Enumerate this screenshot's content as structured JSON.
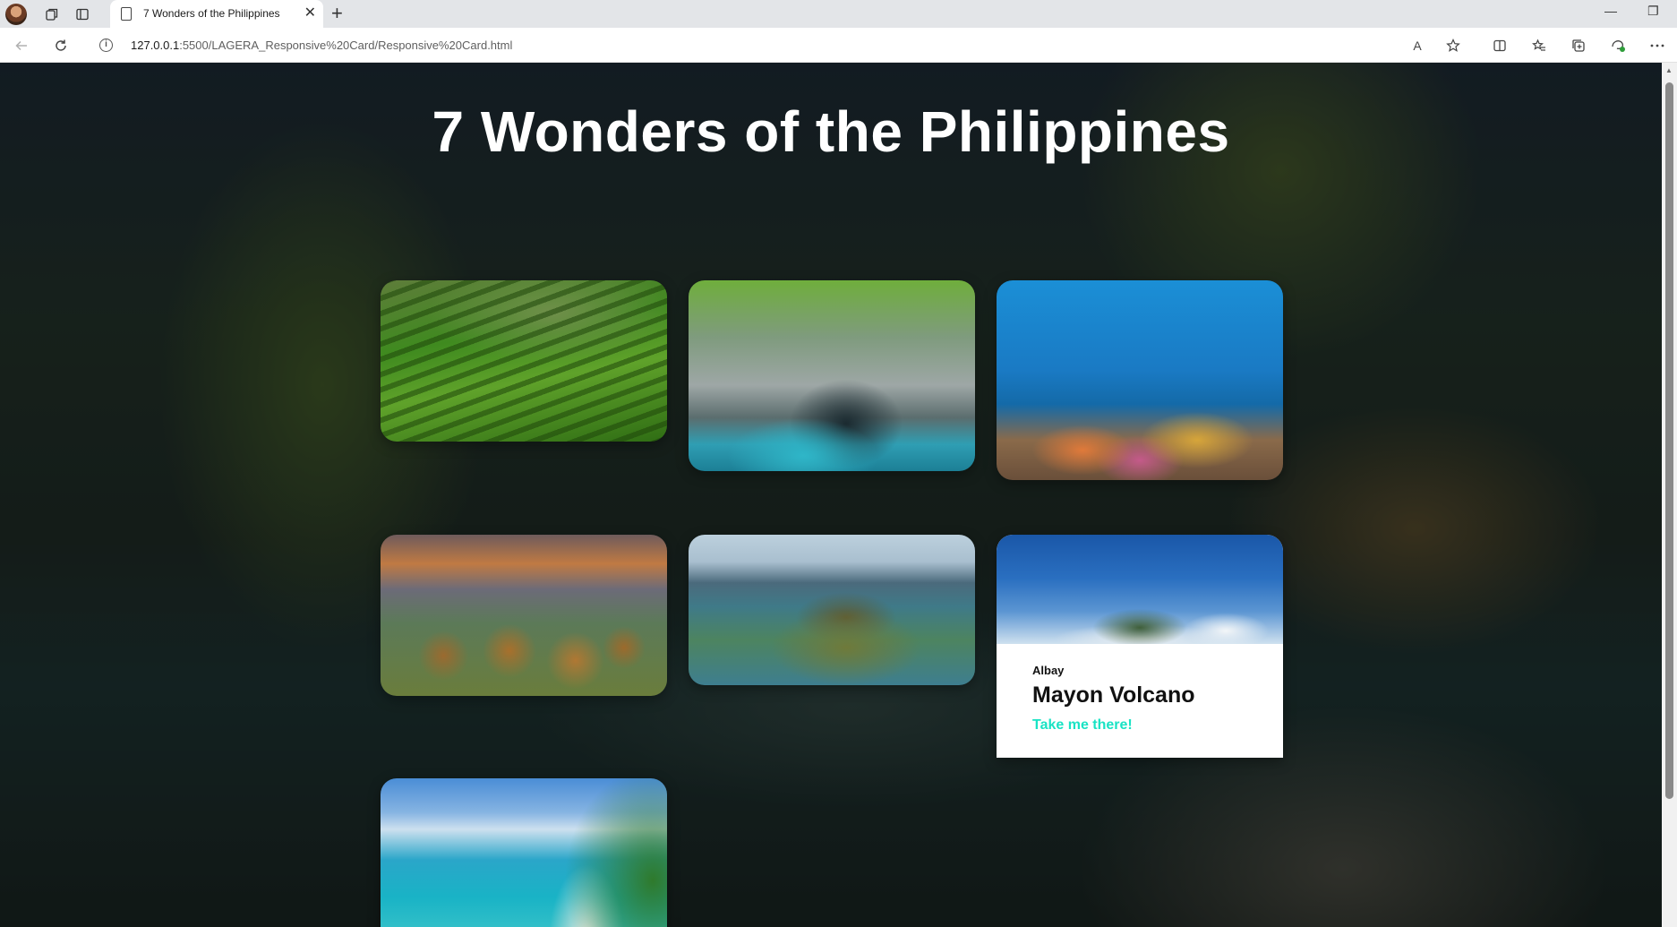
{
  "browser": {
    "tab_title": "7 Wonders of the Philippines",
    "new_tab_symbol": "+",
    "close_symbol": "✕",
    "url_host": "127.0.0.1",
    "url_path": ":5500/LAGERA_Responsive%20Card/Responsive%20Card.html",
    "read_aloud_label": "A",
    "minimize_symbol": "—",
    "maximize_symbol": "❐"
  },
  "page": {
    "title": "7 Wonders of the Philippines"
  },
  "cards": [
    {
      "image": "Banaue Rice Terraces"
    },
    {
      "image": "Underground River"
    },
    {
      "image": "Coral Reef"
    },
    {
      "image": "Chocolate Hills"
    },
    {
      "image": "Taal Volcano"
    },
    {
      "image": "Mayon Volcano",
      "subtitle": "Albay",
      "title": "Mayon Volcano",
      "link": "Take me there!"
    },
    {
      "image": "Boracay Beach"
    }
  ],
  "colors": {
    "accent_link": "#19e3c4",
    "title_text": "#ffffff"
  },
  "icons": [
    "profile-avatar",
    "collections-icon",
    "tab-actions-icon",
    "page-icon",
    "back-icon",
    "refresh-icon",
    "info-icon",
    "read-aloud-icon",
    "favorite-star-icon",
    "split-screen-icon",
    "favorites-icon",
    "collections-icon",
    "extensions-icon",
    "more-icon"
  ]
}
